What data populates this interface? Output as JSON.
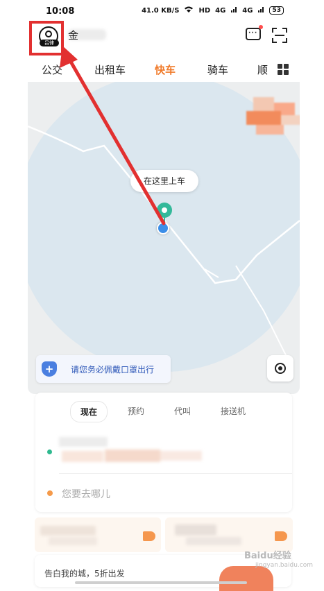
{
  "status_bar": {
    "time": "10:08",
    "network_speed": "41.0 KB/S",
    "hd": "HD",
    "signal_1": "4G",
    "signal_2": "4G",
    "battery": "53"
  },
  "header": {
    "avatar_tag": "吕律",
    "username_visible_char": "金",
    "icons": [
      "message-icon",
      "scan-icon"
    ]
  },
  "tabs": [
    {
      "label": "公交",
      "active": false
    },
    {
      "label": "出租车",
      "active": false
    },
    {
      "label": "快车",
      "active": true
    },
    {
      "label": "骑车",
      "active": false
    },
    {
      "label": "顺",
      "active": false
    }
  ],
  "map": {
    "pickup_label": "在这里上车",
    "mask_notice": "请您务必佩戴口罩出行",
    "shield_symbol": "+"
  },
  "booking": {
    "modes": [
      {
        "label": "现在",
        "active": true
      },
      {
        "label": "预约",
        "active": false
      },
      {
        "label": "代叫",
        "active": false
      },
      {
        "label": "接送机",
        "active": false
      }
    ],
    "destination_placeholder": "您要去哪儿"
  },
  "bottom_banner": {
    "text": "告白我的城，5折出发"
  },
  "watermark": {
    "brand": "Baidu经验",
    "url": "jingyan.baidu.com"
  },
  "colors": {
    "accent": "#f07a2a",
    "annotation_red": "#e23030",
    "pickup_green": "#33b99a",
    "location_blue": "#3b8ee8",
    "notice_blue": "#2d57b8",
    "destination_orange": "#f59a4a"
  }
}
